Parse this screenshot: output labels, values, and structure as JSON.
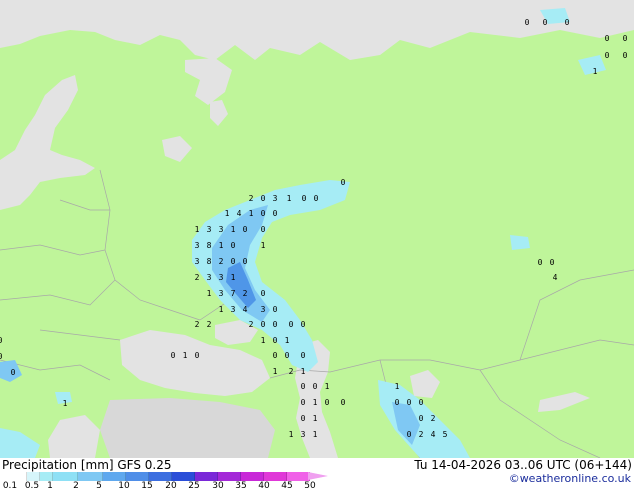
{
  "map": {
    "colors": {
      "land": "#bff59a",
      "sea": "#e3e3e3",
      "border": "#a8a8a8",
      "precip_light": "#a6ecf5",
      "precip_mid": "#7fc8f3",
      "precip_heavy": "#4f96e8"
    },
    "point_labels": [
      "0",
      "0",
      "0",
      "0",
      "0",
      "0",
      "0",
      "2",
      "0",
      "3",
      "1",
      "0",
      "0",
      "0",
      "1",
      "4",
      "1",
      "0",
      "0",
      "1",
      "3",
      "3",
      "1",
      "0",
      "0",
      "3",
      "8",
      "1",
      "0",
      "1",
      "3",
      "8",
      "2",
      "0",
      "0",
      "2",
      "3",
      "3",
      "1",
      "1",
      "3",
      "7",
      "2",
      "0",
      "1",
      "3",
      "4",
      "3",
      "0",
      "2",
      "2",
      "2",
      "0",
      "0",
      "0",
      "0",
      "1",
      "0",
      "1",
      "0",
      "1",
      "0",
      "0",
      "0",
      "0",
      "1",
      "2",
      "1",
      "0",
      "0",
      "1",
      "1",
      "0",
      "1",
      "0",
      "0",
      "0",
      "0",
      "0",
      "0",
      "1",
      "0",
      "2",
      "1",
      "3",
      "1",
      "0",
      "2",
      "4",
      "5",
      "0",
      "0",
      "0",
      "0",
      "0",
      "1",
      "4",
      "1",
      "0",
      "1",
      "0",
      "0"
    ]
  },
  "footer": {
    "title_left": "Precipitation [mm]  GFS 0.25",
    "title_right": "Tu 14-04-2026 03..06 UTC (06+144)",
    "credit": "©weatheronline.co.uk",
    "scale_labels": [
      "0.1",
      "0.5",
      "1",
      "2",
      "5",
      "10",
      "15",
      "20",
      "25",
      "30",
      "35",
      "40",
      "45",
      "50"
    ],
    "scale_colors": [
      "#ffffff",
      "#d6f5fa",
      "#a6ecf5",
      "#8ee0f5",
      "#7fc8f3",
      "#5fa8ee",
      "#4f8ee8",
      "#3c6ee0",
      "#2a4ed8",
      "#7a28d8",
      "#a428d8",
      "#c828d8",
      "#e038d8",
      "#f060e8",
      "#f0a0f0"
    ]
  }
}
